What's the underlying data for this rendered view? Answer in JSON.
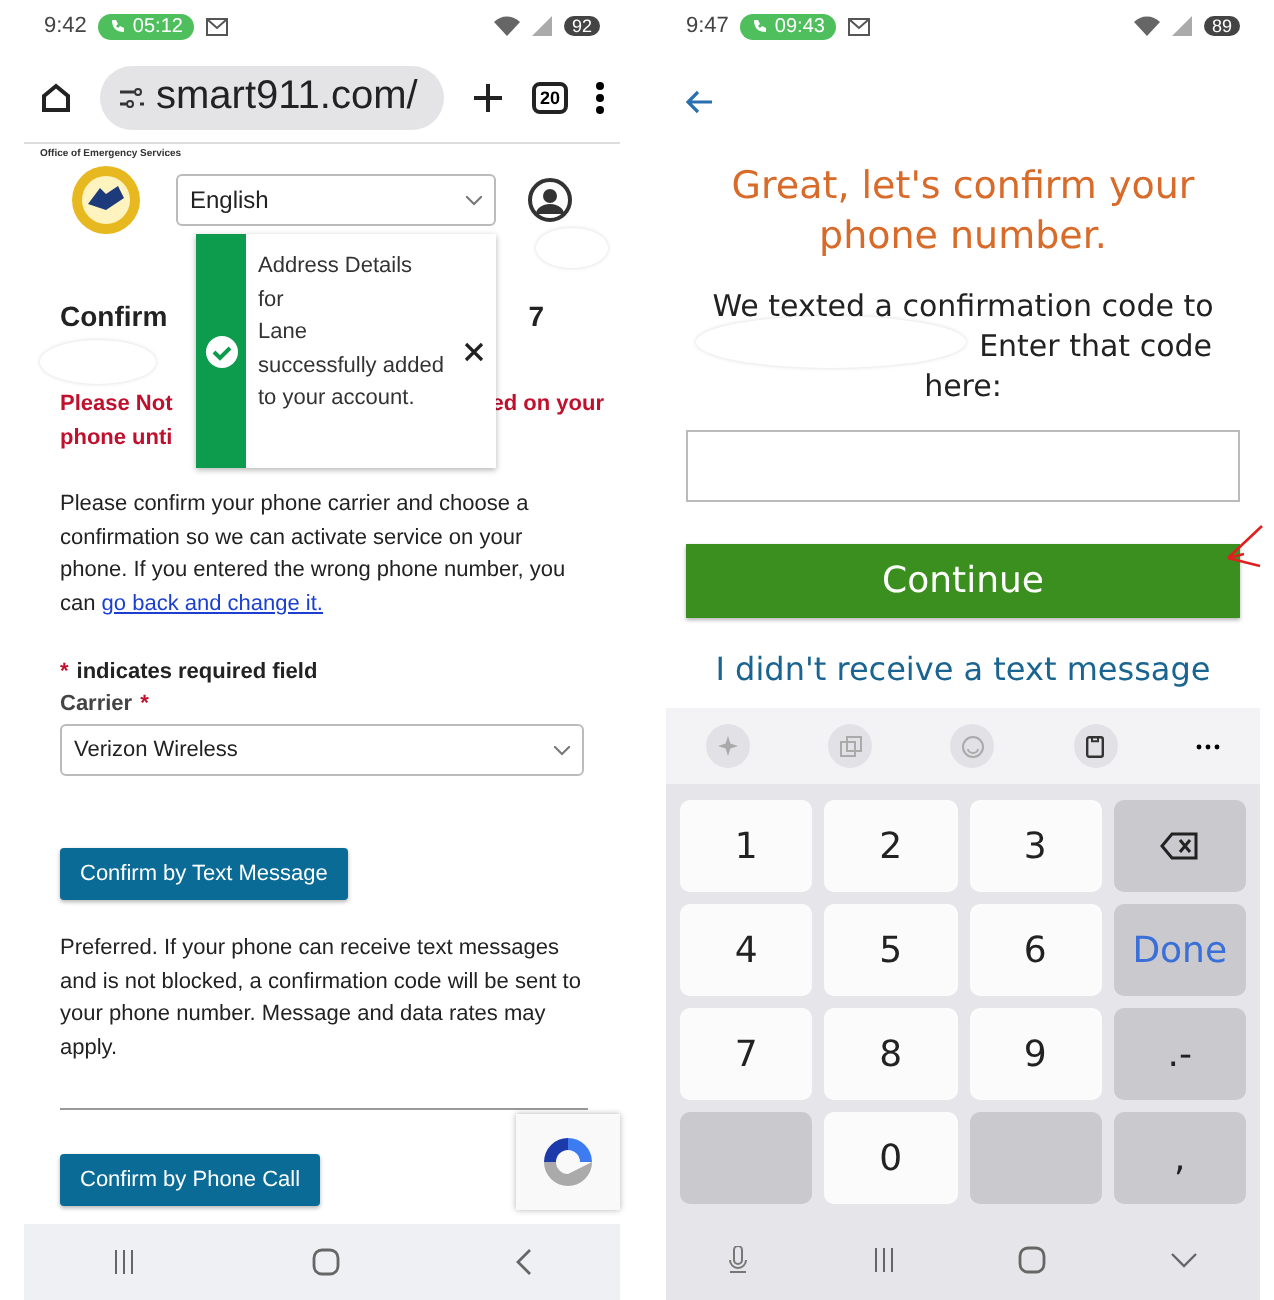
{
  "left_phone": {
    "status_bar": {
      "time": "9:42",
      "call_timer": "05:12",
      "battery": "92"
    },
    "browser": {
      "url": "smart911.com/",
      "tab_count": "20"
    },
    "page": {
      "agency_label": "Office of Emergency Services",
      "language": "English",
      "heading_fragments": [
        "Confirm",
        "7"
      ],
      "toast": {
        "lines": [
          "Address Details",
          "for",
          "Lane",
          "successfully added to your account."
        ]
      },
      "warning_lines": [
        [
          "Please Not",
          "ed on your"
        ],
        [
          "phone unti"
        ]
      ],
      "intro": "Please confirm your phone carrier and choose a confirmation so we can activate service on your phone. If you entered the wrong phone number, you can ",
      "intro_link": "go back and change it.",
      "required_mark": "*",
      "required_note": "indicates required field",
      "carrier_label": "Carrier",
      "carrier_mark": "*",
      "carrier_value": "Verizon Wireless",
      "text_button": "Confirm by Text Message",
      "preferred_text": "Preferred. If your phone can receive text messages and is not blocked, a confirmation code will be sent to your phone number. Message and data rates may apply.",
      "call_button": "Confirm by Phone Call"
    }
  },
  "right_phone": {
    "status_bar": {
      "time": "9:47",
      "call_timer": "09:43",
      "battery": "89"
    },
    "heading": "Great, let's confirm your phone number.",
    "message_lines": [
      "We texted a confirmation code to",
      "Enter that code",
      "here:"
    ],
    "continue_button": "Continue",
    "resend_link": "I didn't receive a text message",
    "keys": [
      {
        "kind": "digit",
        "label": "1"
      },
      {
        "kind": "digit",
        "label": "2"
      },
      {
        "kind": "digit",
        "label": "3"
      },
      {
        "kind": "backspace"
      },
      {
        "kind": "digit",
        "label": "4"
      },
      {
        "kind": "digit",
        "label": "5"
      },
      {
        "kind": "digit",
        "label": "6"
      },
      {
        "kind": "done",
        "label": "Done"
      },
      {
        "kind": "digit",
        "label": "7"
      },
      {
        "kind": "digit",
        "label": "8"
      },
      {
        "kind": "digit",
        "label": "9"
      },
      {
        "kind": "symbol",
        "label": ".-"
      },
      {
        "kind": "blank"
      },
      {
        "kind": "digit",
        "label": "0"
      },
      {
        "kind": "blank"
      },
      {
        "kind": "symbol",
        "label": ","
      }
    ]
  }
}
